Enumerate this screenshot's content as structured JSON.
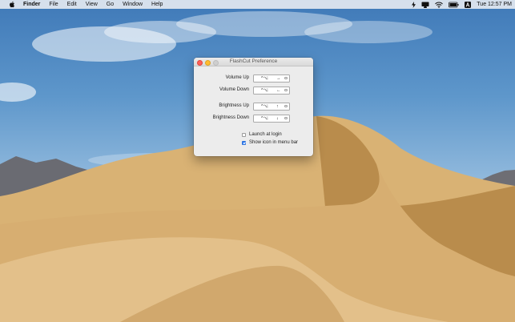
{
  "menubar": {
    "app_name": "Finder",
    "menus": [
      "File",
      "Edit",
      "View",
      "Go",
      "Window",
      "Help"
    ],
    "clock": "Tue 12:57 PM",
    "status_icons": [
      "flash-icon",
      "display-icon",
      "wifi-icon",
      "battery-icon",
      "input-source-icon"
    ]
  },
  "window": {
    "title": "FlashCut Preference",
    "shortcuts": [
      {
        "label": "Volume Up",
        "mods": "^⌥",
        "key": "→"
      },
      {
        "label": "Volume Down",
        "mods": "^⌥",
        "key": "←"
      },
      {
        "label": "Brightness Up",
        "mods": "^⌥",
        "key": "↑"
      },
      {
        "label": "Brightness Down",
        "mods": "^⌥",
        "key": "↓"
      }
    ],
    "options": [
      {
        "label": "Launch at login",
        "checked": false
      },
      {
        "label": "Show icon in menu bar",
        "checked": true
      }
    ]
  },
  "colors": {
    "accent": "#2f7ef6",
    "close": "#ff5f56",
    "minimize": "#ffbd2e"
  }
}
